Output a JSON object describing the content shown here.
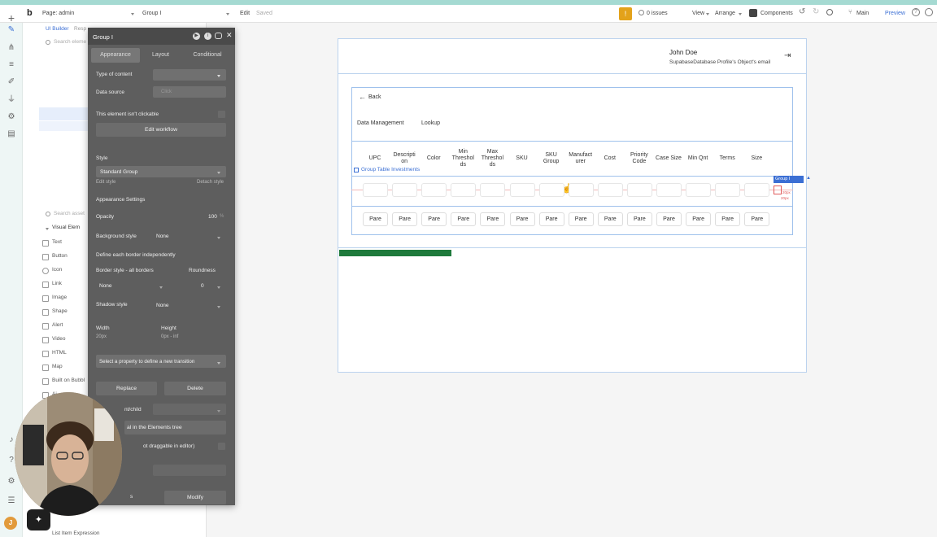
{
  "topbar": {
    "page_label": "Page: admin",
    "element_label": "Group I",
    "edit_label": "Edit",
    "saved_label": "Saved",
    "issues_label": "0 issues",
    "view_label": "View",
    "arrange_label": "Arrange",
    "components_label": "Components",
    "branch_label": "Main",
    "preview_label": "Preview"
  },
  "elements_panel": {
    "tab_ui_builder": "UI Builder",
    "tab_responsive": "Resp",
    "search_elements_placeholder": "Search eleme",
    "search_assets_placeholder": "Search asset",
    "visual_elements_label": "Visual Elem",
    "items": [
      "Text",
      "Button",
      "Icon",
      "Link",
      "Image",
      "Shape",
      "Alert",
      "Video",
      "HTML",
      "Map",
      "Built on Bubbl",
      "Ai"
    ],
    "bottom_item": "List Item Expression"
  },
  "property_editor": {
    "title": "Group I",
    "tabs": [
      "Appearance",
      "Layout",
      "Conditional"
    ],
    "type_of_content_label": "Type of content",
    "data_source_label": "Data source",
    "data_source_placeholder": "Click",
    "not_clickable_label": "This element isn't clickable",
    "edit_workflow_label": "Edit workflow",
    "style_label": "Style",
    "style_value": "Standard Group",
    "edit_style_label": "Edit style",
    "detach_style_label": "Detach style",
    "appearance_settings_label": "Appearance Settings",
    "opacity_label": "Opacity",
    "opacity_value": "100",
    "opacity_unit": "%",
    "background_style_label": "Background style",
    "background_style_value": "None",
    "border_independent_label": "Define each border independently",
    "border_style_label": "Border style - all borders",
    "roundness_label": "Roundness",
    "border_style_value": "None",
    "roundness_value": "0",
    "shadow_style_label": "Shadow style",
    "shadow_style_value": "None",
    "width_label": "Width",
    "width_value": "20px",
    "height_label": "Height",
    "height_value": "0px - inf",
    "transition_placeholder": "Select a property to define a new transition",
    "replace_label": "Replace",
    "delete_label": "Delete",
    "parent_child_label": "nt/child",
    "elements_tree_label": "al in the Elements tree",
    "not_draggable_label": "ot draggable in editor)",
    "modify_label": "Modify",
    "partial_s": "s"
  },
  "canvas": {
    "user_name": "John Doe",
    "user_email": "SupabaseDatabase Profile's Object's email",
    "back_label": "Back",
    "tab_data_management": "Data Management",
    "tab_lookup": "Lookup",
    "group_label": "Group Table Investments",
    "columns": [
      "UPC",
      "Descripti\non",
      "Color",
      "Min\nThreshol\nds",
      "Max\nThreshol\nds",
      "SKU",
      "SKU\nGroup",
      "Manufact\nurer",
      "Cost",
      "Priority\nCode",
      "Case Size",
      "Min Qnt",
      "Terms",
      "Size"
    ],
    "row_value": "Pare",
    "row_count": 14,
    "selection_badge": "Group I",
    "dim_20px": "20px",
    "dim_9px": "9px"
  },
  "colors": {
    "teal": "#a5dad2",
    "accent_blue": "#3b6fd4",
    "panel_gray": "#5e5e5e",
    "warning_orange": "#e3a21a",
    "measure_red": "#e05a5a"
  }
}
